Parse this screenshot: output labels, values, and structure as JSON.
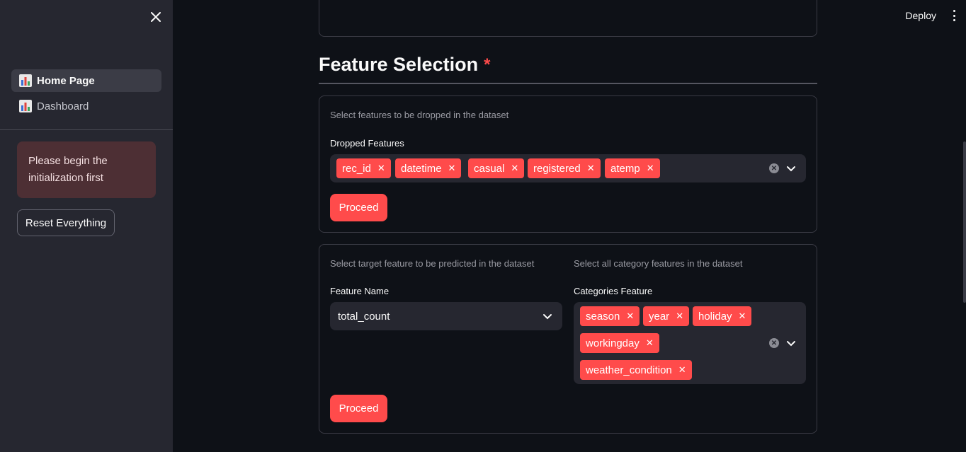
{
  "sidebar": {
    "close_icon": "close-icon",
    "items": [
      {
        "label": "Home Page",
        "icon": "bar-chart-icon",
        "active": true
      },
      {
        "label": "Dashboard",
        "icon": "bar-chart-icon",
        "active": false
      }
    ],
    "alert_text": "Please begin the initialization first",
    "reset_label": "Reset Everything"
  },
  "header": {
    "deploy_label": "Deploy",
    "menu_icon": "kebab-menu-icon"
  },
  "section": {
    "title": "Feature Selection",
    "required_mark": "*"
  },
  "drop_card": {
    "caption": "Select features to be dropped in the dataset",
    "label": "Dropped Features",
    "tags": [
      "rec_id",
      "datetime",
      "casual",
      "registered",
      "atemp"
    ],
    "button": "Proceed"
  },
  "target_card": {
    "target_caption": "Select target feature to be predicted in the dataset",
    "target_label": "Feature Name",
    "target_value": "total_count",
    "category_caption": "Select all category features in the dataset",
    "category_label": "Categories Feature",
    "category_tags": [
      "season",
      "year",
      "holiday",
      "workingday",
      "weather_condition"
    ],
    "button": "Proceed"
  },
  "colors": {
    "accent": "#ff4b4b",
    "background": "#0e1117",
    "sidebar": "#262730",
    "alert_bg": "#4d2f34"
  }
}
